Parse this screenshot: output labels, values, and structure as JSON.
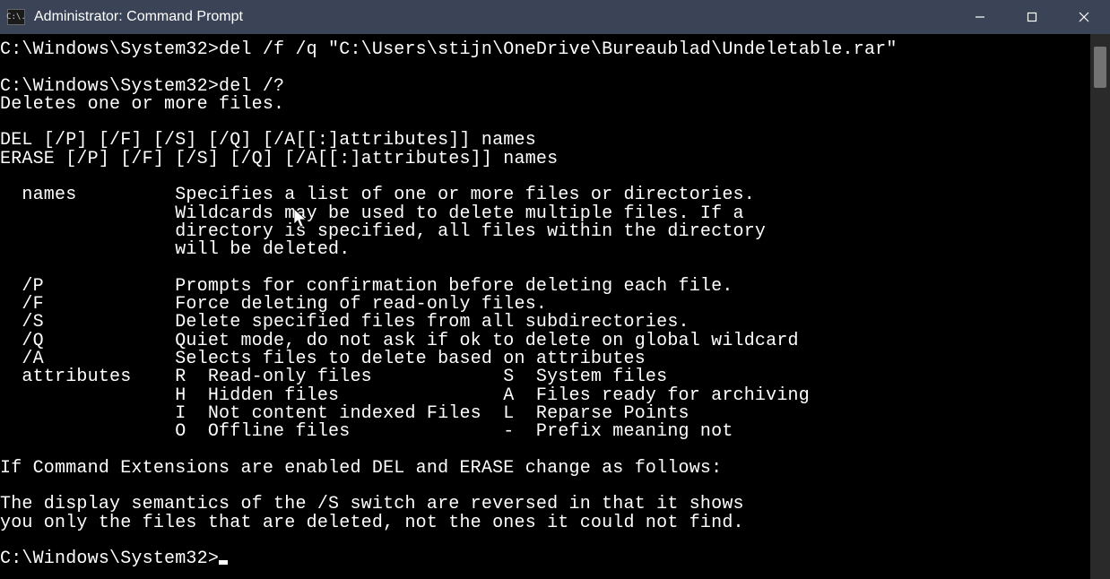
{
  "window": {
    "title": "Administrator: Command Prompt",
    "app_icon_text": "C:\\."
  },
  "terminal": {
    "lines": [
      "C:\\Windows\\System32>del /f /q \"C:\\Users\\stijn\\OneDrive\\Bureaublad\\Undeletable.rar\"",
      "",
      "C:\\Windows\\System32>del /?",
      "Deletes one or more files.",
      "",
      "DEL [/P] [/F] [/S] [/Q] [/A[[:]attributes]] names",
      "ERASE [/P] [/F] [/S] [/Q] [/A[[:]attributes]] names",
      "",
      "  names         Specifies a list of one or more files or directories.",
      "                Wildcards may be used to delete multiple files. If a",
      "                directory is specified, all files within the directory",
      "                will be deleted.",
      "",
      "  /P            Prompts for confirmation before deleting each file.",
      "  /F            Force deleting of read-only files.",
      "  /S            Delete specified files from all subdirectories.",
      "  /Q            Quiet mode, do not ask if ok to delete on global wildcard",
      "  /A            Selects files to delete based on attributes",
      "  attributes    R  Read-only files            S  System files",
      "                H  Hidden files               A  Files ready for archiving",
      "                I  Not content indexed Files  L  Reparse Points",
      "                O  Offline files              -  Prefix meaning not",
      "",
      "If Command Extensions are enabled DEL and ERASE change as follows:",
      "",
      "The display semantics of the /S switch are reversed in that it shows",
      "you only the files that are deleted, not the ones it could not find.",
      "",
      "C:\\Windows\\System32>"
    ],
    "prompt_has_cursor": true
  }
}
